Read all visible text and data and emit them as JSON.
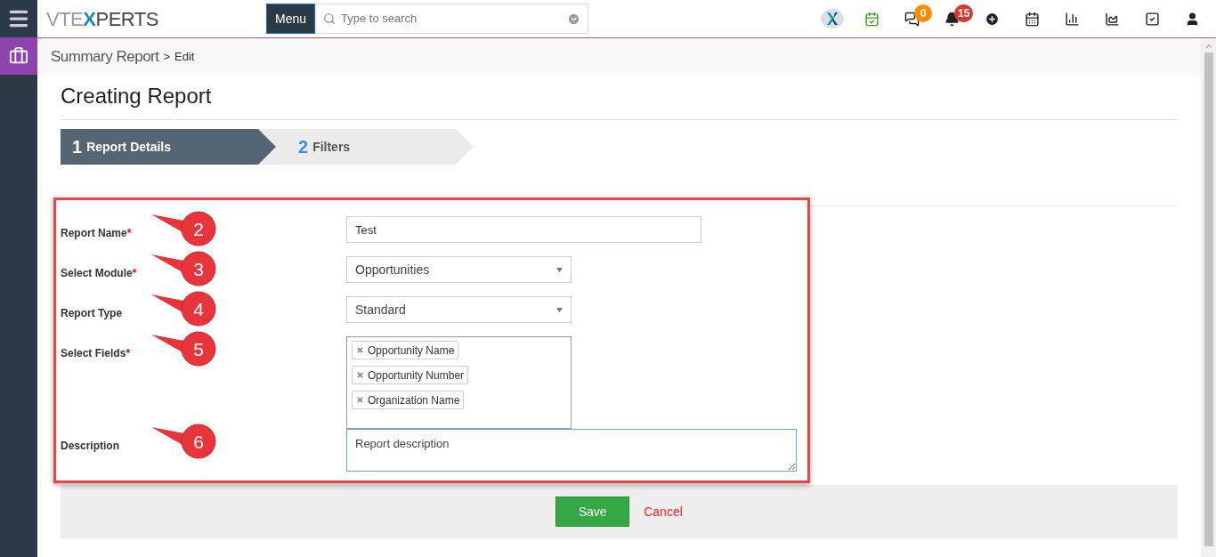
{
  "logo": {
    "text_left": "VTE",
    "text_mark": "X",
    "text_right": "PERTS"
  },
  "menu_button": "Menu",
  "search": {
    "placeholder": "Type to search"
  },
  "toolbar": [
    {
      "kind": "brand"
    },
    {
      "kind": "calendar-check"
    },
    {
      "kind": "chat",
      "badge": "0",
      "color": "#ff8c00"
    },
    {
      "kind": "bell",
      "badge": "15",
      "color": "#d9372b"
    },
    {
      "kind": "plus"
    },
    {
      "kind": "calendar"
    },
    {
      "kind": "bar-chart"
    },
    {
      "kind": "area-chart"
    },
    {
      "kind": "checkbox"
    },
    {
      "kind": "user"
    }
  ],
  "breadcrumb": {
    "title": "Summary Report",
    "separator": ">",
    "current": "Edit"
  },
  "page_title": "Creating Report",
  "steps": [
    {
      "number": "1",
      "label": "Report Details",
      "selected": true
    },
    {
      "number": "2",
      "label": "Filters",
      "selected": false
    }
  ],
  "fields": [
    {
      "kind": "text",
      "label": "Report Name",
      "required_mark": "*",
      "value": "Test",
      "callout": "2"
    },
    {
      "kind": "select",
      "label": "Select Module",
      "required_mark": "*",
      "value": "Opportunities",
      "callout": "3"
    },
    {
      "kind": "select",
      "label": "Report Type",
      "value": "Standard",
      "callout": "4"
    },
    {
      "kind": "multiselect",
      "label": "Select Fields",
      "required_mark": "*",
      "tags": [
        "Opportunity Name",
        "Opportunity Number",
        "Organization Name"
      ],
      "callout": "5"
    },
    {
      "kind": "textarea",
      "label": "Description",
      "value": "Report description",
      "callout": "6"
    }
  ],
  "buttons": {
    "save": "Save",
    "cancel": "Cancel"
  }
}
